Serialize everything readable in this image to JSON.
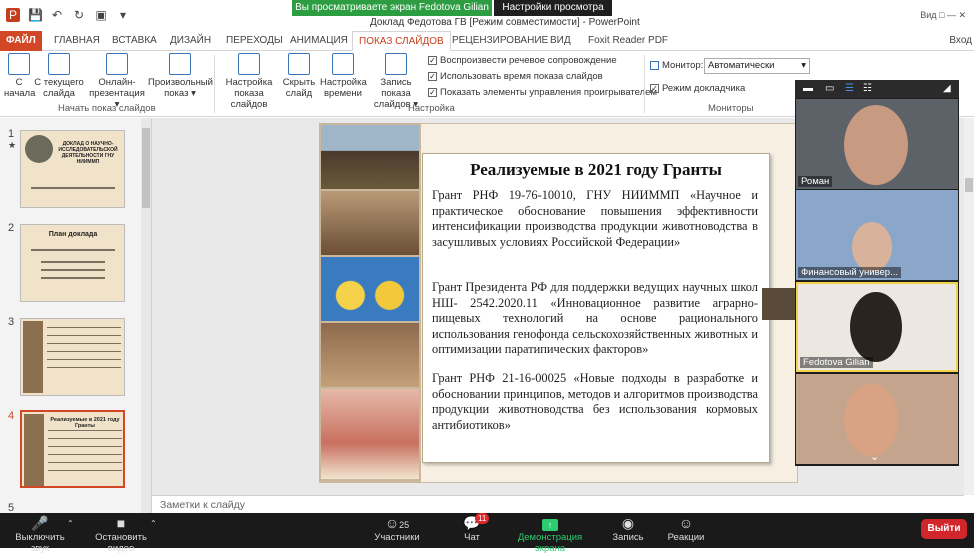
{
  "window": {
    "title": "Доклад Федотова ГВ [Режим совместимости] - PowerPoint",
    "share_banner": "Вы просматриваете экран Fedotova Gilian",
    "view_settings": "Настройки просмотра",
    "window_controls": "Вид □ — ✕",
    "signin": "Вход"
  },
  "tabs": [
    {
      "label": "ФАЙЛ"
    },
    {
      "label": "ГЛАВНАЯ"
    },
    {
      "label": "ВСТАВКА"
    },
    {
      "label": "ДИЗАЙН"
    },
    {
      "label": "ПЕРЕХОДЫ"
    },
    {
      "label": "АНИМАЦИЯ"
    },
    {
      "label": "ПОКАЗ СЛАЙДОВ"
    },
    {
      "label": "РЕЦЕНЗИРОВАНИЕ"
    },
    {
      "label": "ВИД"
    },
    {
      "label": "Foxit Reader PDF"
    }
  ],
  "ribbon": {
    "buttons": [
      {
        "label": "С\nначала"
      },
      {
        "label": "С текущего\nслайда"
      },
      {
        "label": "Онлайн-\nпрезентация ▾"
      },
      {
        "label": "Произвольный\nпоказ ▾"
      },
      {
        "label": "Настройка\nпоказа слайдов"
      },
      {
        "label": "Скрыть\nслайд"
      },
      {
        "label": "Настройка\nвремени"
      },
      {
        "label": "Запись показа\nслайдов ▾"
      }
    ],
    "groups": {
      "start": "Начать показ слайдов",
      "setup": "Настройка",
      "monitors": "Мониторы"
    },
    "checkboxes": [
      {
        "label": "Воспроизвести речевое сопровождение",
        "checked": "✓"
      },
      {
        "label": "Использовать время показа слайдов",
        "checked": "✓"
      },
      {
        "label": "Показать элементы управления проигрывателем",
        "checked": "✓"
      }
    ],
    "monitor_label": "Монитор:",
    "monitor_value": "Автоматически",
    "presenter_view": "Режим докладчика"
  },
  "thumbnails": [
    {
      "num": "1",
      "title": "ДОКЛАД О НАУЧНО-ИССЛЕДОВАТЕЛЬСКОЙ ДЕЯТЕЛЬНОСТИ ГНУ НИИММП"
    },
    {
      "num": "2",
      "title": "План доклада"
    },
    {
      "num": "3",
      "title": ""
    },
    {
      "num": "4",
      "title": "Реализуемые в 2021 году Гранты"
    },
    {
      "num": "5",
      "title": ""
    }
  ],
  "slide": {
    "title": "Реализуемые в 2021 году Гранты",
    "paragraphs": [
      "Грант РНФ 19-76-10010, ГНУ НИИММП «Научное и практическое обоснование повышения эффективности интенсификации производства продукции животноводства в засушливых условиях Российской Федерации»",
      "Грант Президента РФ для поддержки ведущих научных школ НШ- 2542.2020.11 «Инновационное развитие аграрно-пищевых технологий на основе рационального использования генофонда сельскохозяйственных животных и оптимизации паратипических факторов»",
      "Грант РНФ 21-16-00025 «Новые подходы в разработке и обосновании принципов, методов и алгоритмов производства продукции животноводства без использования кормовых антибиотиков»"
    ]
  },
  "notes_placeholder": "Заметки к слайду",
  "participants": [
    {
      "name": "Роман"
    },
    {
      "name": "Финансовый универ..."
    },
    {
      "name": "Fedotova Gilian"
    },
    {
      "name": ""
    }
  ],
  "zoom": {
    "mute": "Выключить звук",
    "video": "Остановить видео",
    "participants": "Участники",
    "participants_count": "25",
    "chat": "Чат",
    "chat_badge": "11",
    "share": "Демонстрация экрана",
    "record": "Запись",
    "reactions": "Реакции",
    "leave": "Выйти"
  }
}
